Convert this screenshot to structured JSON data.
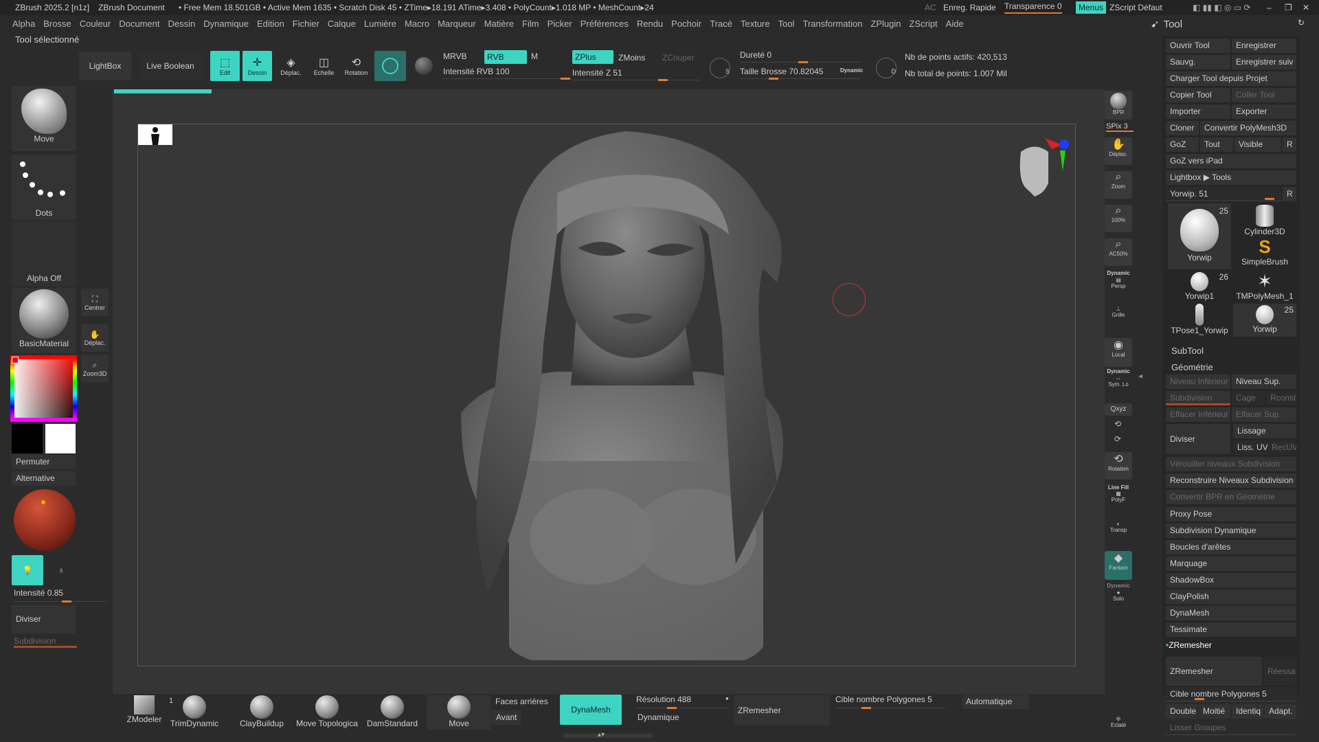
{
  "titlebar": {
    "app": "ZBrush 2025.2 [n1z]",
    "doc": "ZBrush Document",
    "stats": "• Free Mem 18.501GB • Active Mem 1635 • Scratch Disk 45 • ZTime▸18.191 ATime▸3.408 • PolyCount▸1.018 MP • MeshCount▸24",
    "ac": "AC",
    "quicksave": "Enreg. Rapide",
    "transp": "Transparence 0",
    "menus": "Menus",
    "zscript": "ZScript Défaut"
  },
  "menu": [
    "Alpha",
    "Brosse",
    "Couleur",
    "Document",
    "Dessin",
    "Dynamique",
    "Edition",
    "Fichier",
    "Calque",
    "Lumière",
    "Macro",
    "Marqueur",
    "Matière",
    "Film",
    "Picker",
    "Préférences",
    "Rendu",
    "Pochoir",
    "Tracé",
    "Texture",
    "Tool",
    "Transformation",
    "ZPlugin",
    "ZScript",
    "Aide"
  ],
  "tool_selected": "Tool sélectionné",
  "toolbar": {
    "lightbox": "LightBox",
    "liveboolean": "Live Boolean",
    "edit": "Edit",
    "dessin": "Dessin",
    "deplac": "Déplac.",
    "echelle": "Echelle",
    "rotation": "Rotation",
    "mrvb": "MRVB",
    "rvb": "RVB",
    "m": "M",
    "intensite_rvb": "Intensité RVB 100",
    "zplus": "ZPlus",
    "zmoins": "ZMoins",
    "zcouper": "ZCouper",
    "intensite_z": "Intensité Z 51",
    "durete": "Dureté 0",
    "taille": "Taille Brosse 70.82045",
    "dynamic": "Dynamic",
    "s": "S",
    "d": "D",
    "actifs": "Nb de points actifs: 420,513",
    "total": "Nb total de points: 1.007 Mil"
  },
  "left": {
    "move": "Move",
    "dots": "Dots",
    "alpha": "Alpha Off",
    "material": "BasicMaterial",
    "centrer": "Centrer",
    "deplac": "Déplac.",
    "zoom3d": "Zoom3D",
    "permuter": "Permuter",
    "alternative": "Alternative",
    "intensite": "Intensité 0.85",
    "diviser": "Diviser",
    "subdivision": "Subdivision",
    "colors": {
      "primary": "#000000",
      "secondary": "#ffffff",
      "accent": "#3ed4c2"
    }
  },
  "rightbar": {
    "bpr": "BPR",
    "spix": "SPix 3",
    "deplac": "Déplac.",
    "zoom": "Zoom",
    "z100": "100%",
    "ac50": "AC50%",
    "dynamic": "Dynamic",
    "persp": "Persp",
    "grille": "Grille",
    "local": "Local",
    "symlo": "Sym. Lo",
    "xyz": "Qxyz",
    "rotation": "Rotation",
    "linefill": "Line Fill",
    "polyf": "PolyF",
    "transp": "Transp",
    "fantom": "Fantom",
    "solo": "Solo",
    "eclate": "Eclaté"
  },
  "toolpanel": {
    "title": "Tool",
    "ouvrir": "Ouvrir Tool",
    "enregistrer": "Enregistrer",
    "sauvg": "Sauvg.",
    "enregsuiv": "Enregistrer suiv",
    "charger": "Charger Tool depuis Projet",
    "copier": "Copier Tool",
    "coller": "Coller Tool",
    "importer": "Importer",
    "exporter": "Exporter",
    "cloner": "Cloner",
    "convertir": "Convertir PolyMesh3D",
    "goz": "GoZ",
    "tout": "Tout",
    "visible": "Visible",
    "r": "R",
    "gozipad": "GoZ vers iPad",
    "lightbox": "Lightbox ▶ Tools",
    "yorwip": "Yorwip. 51",
    "thumbs": [
      {
        "name": "Yorwip",
        "count": "25"
      },
      {
        "name": "Cylinder3D",
        "count": ""
      },
      {
        "name": "SimpleBrush",
        "count": ""
      },
      {
        "name": "Yorwip1",
        "count": "26"
      },
      {
        "name": "TMPolyMesh_1",
        "count": ""
      },
      {
        "name": "TPose1_Yorwip",
        "count": ""
      },
      {
        "name": "Yorwip",
        "count": "25"
      }
    ],
    "subtool": "SubTool",
    "geometrie": "Géométrie",
    "niveauinf": "Niveau Inférieur",
    "niveausup": "Niveau Sup.",
    "subdivision": "Subdivision",
    "cage": "Cage",
    "rconst": "Rconst",
    "effinf": "Effacer Inférieur",
    "effsup": "Effacer Sup.",
    "diviser": "Diviser",
    "lissage": "Lissage",
    "lissuv": "Liss. UV",
    "recuv": "RecUV",
    "verrouiller": "Vérouiller niveaux Subdivision",
    "reconstruire": "Reconstruire Niveaux Subdivision",
    "convertirbpr": "Convertir BPR en Géométrie",
    "proxy": "Proxy Pose",
    "subdyn": "Subdivision Dynamique",
    "boucles": "Boucles d'arêtes",
    "marquage": "Marquage",
    "shadowbox": "ShadowBox",
    "claypolish": "ClayPolish",
    "dynamesh": "DynaMesh",
    "tessimate": "Tessimate",
    "zremesher_h": "ZRemesher",
    "zremesher": "ZRemesher",
    "reessa": "Réessa",
    "cible": "Cible nombre Polygones 5",
    "double": "Double",
    "moitie": "Moitié",
    "identiq": "Identiq",
    "adapt": "Adapt.",
    "lisser": "Lisser Groupes"
  },
  "bottom": {
    "zmodeler": "ZModeler",
    "one": "1",
    "trimdynamic": "TrimDynamic",
    "claybuildup": "ClayBuildup",
    "movetopo": "Move Topologica",
    "damstandard": "DamStandard",
    "move": "Move",
    "faces": "Faces arrières",
    "avant": "Avant",
    "dynamesh": "DynaMesh",
    "resolution": "Résolution 488",
    "dynamique": "Dynamique",
    "zremesher": "ZRemesher",
    "cible": "Cible nombre Polygones 5",
    "auto": "Automatique"
  }
}
